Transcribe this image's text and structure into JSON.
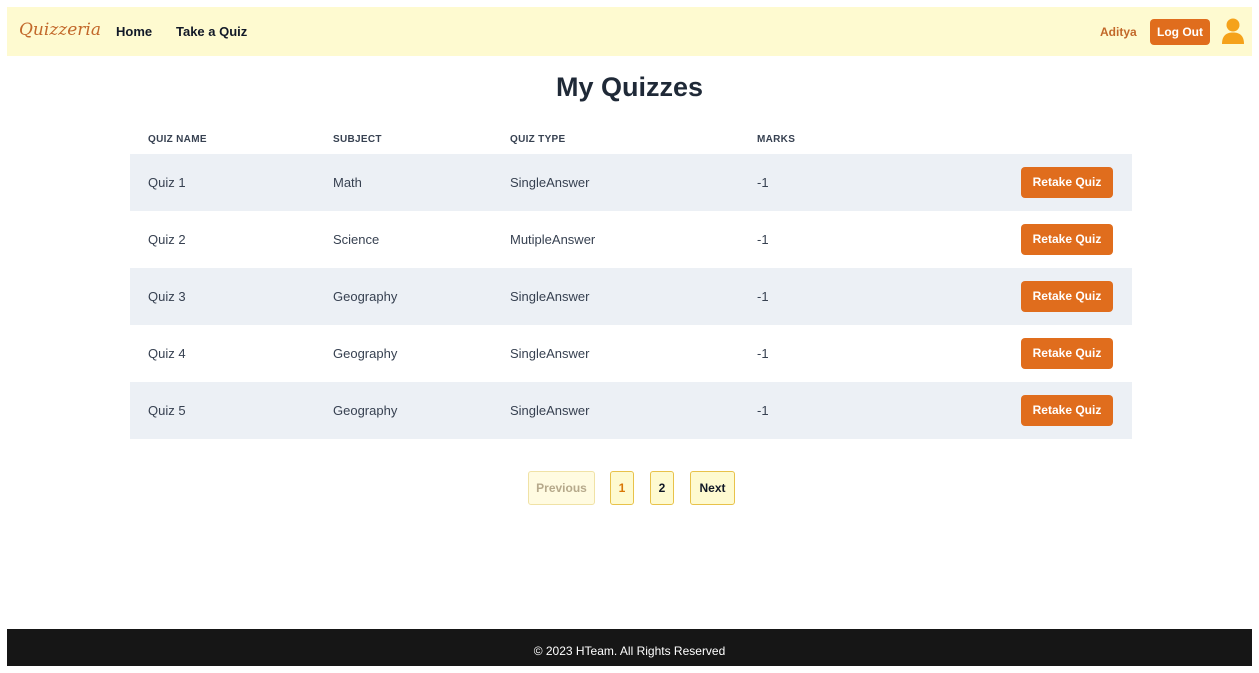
{
  "navbar": {
    "brand": "Quizzeria",
    "links": [
      "Home",
      "Take a Quiz"
    ],
    "username": "Aditya",
    "logout_label": "Log Out"
  },
  "page_title": "My Quizzes",
  "table": {
    "headers": [
      "QUIZ NAME",
      "SUBJECT",
      "QUIZ TYPE",
      "MARKS"
    ],
    "rows": [
      {
        "name": "Quiz 1",
        "subject": "Math",
        "type": "SingleAnswer",
        "marks": "-1",
        "action": "Retake Quiz"
      },
      {
        "name": "Quiz 2",
        "subject": "Science",
        "type": "MutipleAnswer",
        "marks": "-1",
        "action": "Retake Quiz"
      },
      {
        "name": "Quiz 3",
        "subject": "Geography",
        "type": "SingleAnswer",
        "marks": "-1",
        "action": "Retake Quiz"
      },
      {
        "name": "Quiz 4",
        "subject": "Geography",
        "type": "SingleAnswer",
        "marks": "-1",
        "action": "Retake Quiz"
      },
      {
        "name": "Quiz 5",
        "subject": "Geography",
        "type": "SingleAnswer",
        "marks": "-1",
        "action": "Retake Quiz"
      }
    ]
  },
  "pagination": {
    "previous": "Previous",
    "pages": [
      "1",
      "2"
    ],
    "current_page": "1",
    "next": "Next"
  },
  "footer": {
    "text": "© 2023 HTeam. All Rights Reserved"
  },
  "colors": {
    "navbar_bg": "#fefad0",
    "accent": "#e06d1d",
    "brand": "#c2682a",
    "row_shade": "#ecf0f5",
    "footer_bg": "#161616"
  },
  "icons": {
    "avatar": "user-icon"
  }
}
